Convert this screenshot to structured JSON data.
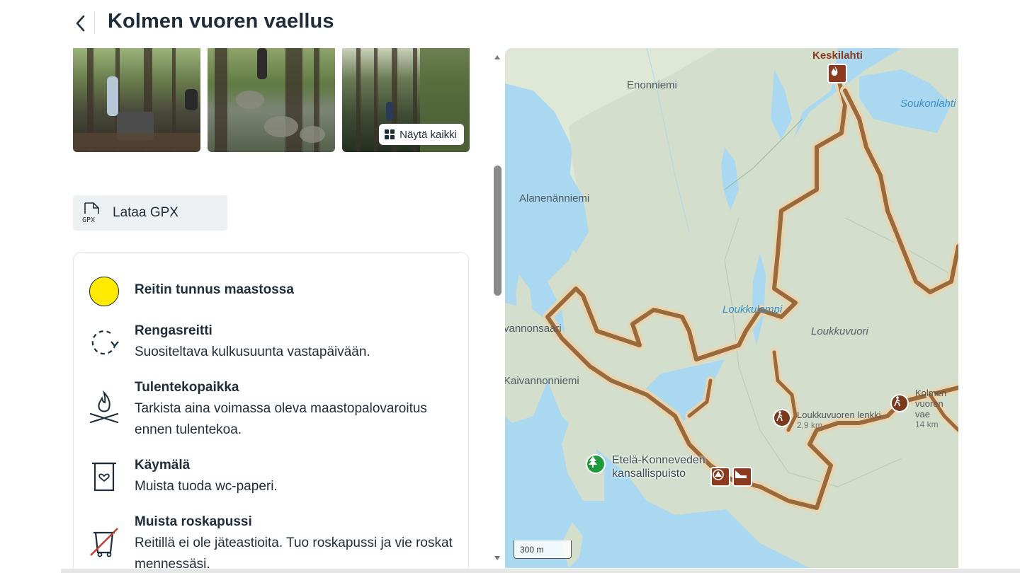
{
  "header": {
    "title": "Kolmen vuoren vaellus",
    "back_icon": "chevron-left-icon"
  },
  "gallery": {
    "show_all_label": "Näytä kaikki",
    "photos": [
      "photo-1",
      "photo-2",
      "photo-3"
    ]
  },
  "gpx": {
    "label": "Lataa GPX",
    "icon": "gpx-file-icon"
  },
  "info": {
    "items": [
      {
        "title": "Reitin tunnus maastossa",
        "desc": "",
        "icon": "yellow-dot-icon",
        "color": "#ffea00"
      },
      {
        "title": "Rengasreitti",
        "desc": "Suositeltava kulkusuunta vastapäivään.",
        "icon": "loop-route-icon"
      },
      {
        "title": "Tulentekopaikka",
        "desc": "Tarkista aina voimassa oleva maastopalovaroitus ennen tulentekoa.",
        "icon": "campfire-icon"
      },
      {
        "title": "Käymälä",
        "desc": "Muista tuoda wc-paperi.",
        "icon": "toilet-icon"
      },
      {
        "title": "Muista roskapussi",
        "desc": "Reitillä ei ole jäteastioita. Tuo roskapussi ja vie roskat mennessäsi.",
        "icon": "no-trash-icon"
      }
    ]
  },
  "map": {
    "places": {
      "keskilahti": "Keskilahti",
      "enonniemi": "Enonniemi",
      "soukonlahti": "Soukonlahti",
      "alanenanniemi": "Alanenänniemi",
      "loukkulampi": "Loukkulampi",
      "loukkuvuori": "Loukkuvuori",
      "vannonsaari": "vannonsaari",
      "kaivannonniemi": "Kaivannonniemi"
    },
    "park": {
      "line1": "Etelä-Konneveden",
      "line2": "kansallispuisto"
    },
    "routes": [
      {
        "name": "Loukkuvuoren lenkki",
        "distance": "2,9 km"
      },
      {
        "name_line1": "Kolmen",
        "name_line2": "vuoren vae",
        "distance": "14 km"
      }
    ],
    "scale": "300 m",
    "colors": {
      "water": "#a9d8f0",
      "land": "#d6e3cf",
      "trail": "#9a6a3c",
      "poi": "#8b3a1f"
    }
  }
}
